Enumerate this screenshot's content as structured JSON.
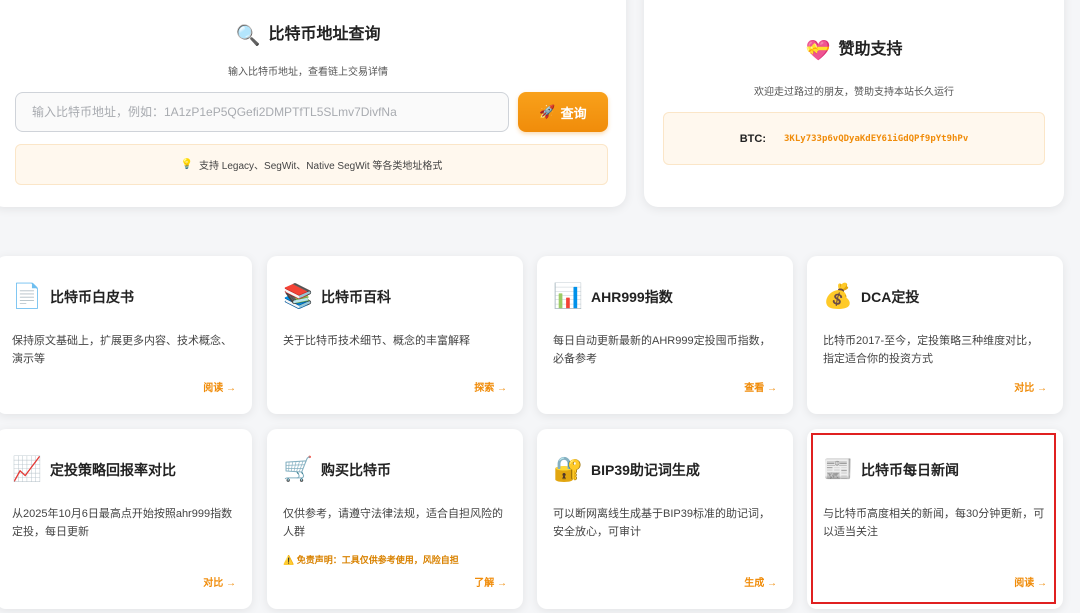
{
  "search": {
    "icon": "magnifier-icon",
    "title": "比特币地址查询",
    "subtitle": "输入比特币地址，查看链上交易详情",
    "placeholder": "输入比特币地址，例如：1A1zP1eP5QGefi2DMPTfTL5SLmv7DivfNa",
    "button_icon": "rocket-icon",
    "button_label": "查询",
    "tip_icon": "lightbulb-icon",
    "tip": "支持 Legacy、SegWit、Native SegWit 等各类地址格式"
  },
  "donate": {
    "icon": "heart-gift-icon",
    "title": "赞助支持",
    "subtitle": "欢迎走过路过的朋友，赞助支持本站长久运行",
    "btc_label": "BTC:",
    "btc_address": "3KLy733p6vQDyaKdEY61iGdQPf9pYt9hPv"
  },
  "cards": [
    {
      "icon": "document-icon",
      "title": "比特币白皮书",
      "desc": "保持原文基础上，扩展更多内容、技术概念、演示等",
      "link": "阅读 →"
    },
    {
      "icon": "books-icon",
      "title": "比特币百科",
      "desc": "关于比特币技术细节、概念的丰富解释",
      "link": "探索 →"
    },
    {
      "icon": "bar-chart-icon",
      "title": "AHR999指数",
      "desc": "每日自动更新最新的AHR999定投囤币指数，必备参考",
      "link": "查看 →"
    },
    {
      "icon": "money-bag-icon",
      "title": "DCA定投",
      "desc": "比特币2017-至今，定投策略三种维度对比，指定适合你的投资方式",
      "link": "对比 →"
    },
    {
      "icon": "trend-up-icon",
      "title": "定投策略回报率对比",
      "desc": "从2025年10月6日最高点开始按照ahr999指数定投，每日更新",
      "link": "对比 →"
    },
    {
      "icon": "shopping-cart-icon",
      "title": "购买比特币",
      "desc": "仅供参考，请遵守法律法规，适合自担风险的人群",
      "warning": "⚠️ 免责声明：工具仅供参考使用，风险自担",
      "link": "了解 →"
    },
    {
      "icon": "lock-icon",
      "title": "BIP39助记词生成",
      "desc": "可以断网离线生成基于BIP39标准的助记词，安全放心，可审计",
      "link": "生成 →"
    },
    {
      "icon": "newspaper-icon",
      "title": "比特币每日新闻",
      "desc": "与比特币高度相关的新闻，每30分钟更新，可以适当关注",
      "link": "阅读 →"
    }
  ],
  "colors": {
    "accent": "#f08c0a",
    "highlight": "#e02020",
    "tip_bg": "#fff8ee"
  }
}
